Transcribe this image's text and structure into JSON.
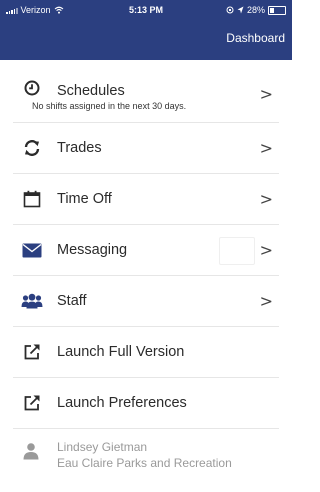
{
  "status_bar": {
    "carrier": "Verizon",
    "time": "5:13 PM",
    "battery": "28%"
  },
  "header": {
    "dashboard_link": "Dashboard"
  },
  "menu": {
    "items": [
      {
        "label": "Schedules",
        "sublabel": "No shifts assigned in the next 30 days.",
        "icon": "clock-icon"
      },
      {
        "label": "Trades",
        "icon": "refresh-icon"
      },
      {
        "label": "Time Off",
        "icon": "calendar-icon"
      },
      {
        "label": "Messaging",
        "icon": "envelope-icon"
      },
      {
        "label": "Staff",
        "icon": "users-icon"
      },
      {
        "label": "Launch Full Version",
        "icon": "external-link-icon"
      },
      {
        "label": "Launch Preferences",
        "icon": "external-link-icon"
      }
    ],
    "chevron": ">"
  },
  "user": {
    "name": "Lindsey Gietman",
    "organization": "Eau Claire Parks and Recreation"
  },
  "colors": {
    "header_bg": "#2b3f80",
    "icon_color": "#2b2b2b",
    "user_text": "#9a9a9a"
  }
}
